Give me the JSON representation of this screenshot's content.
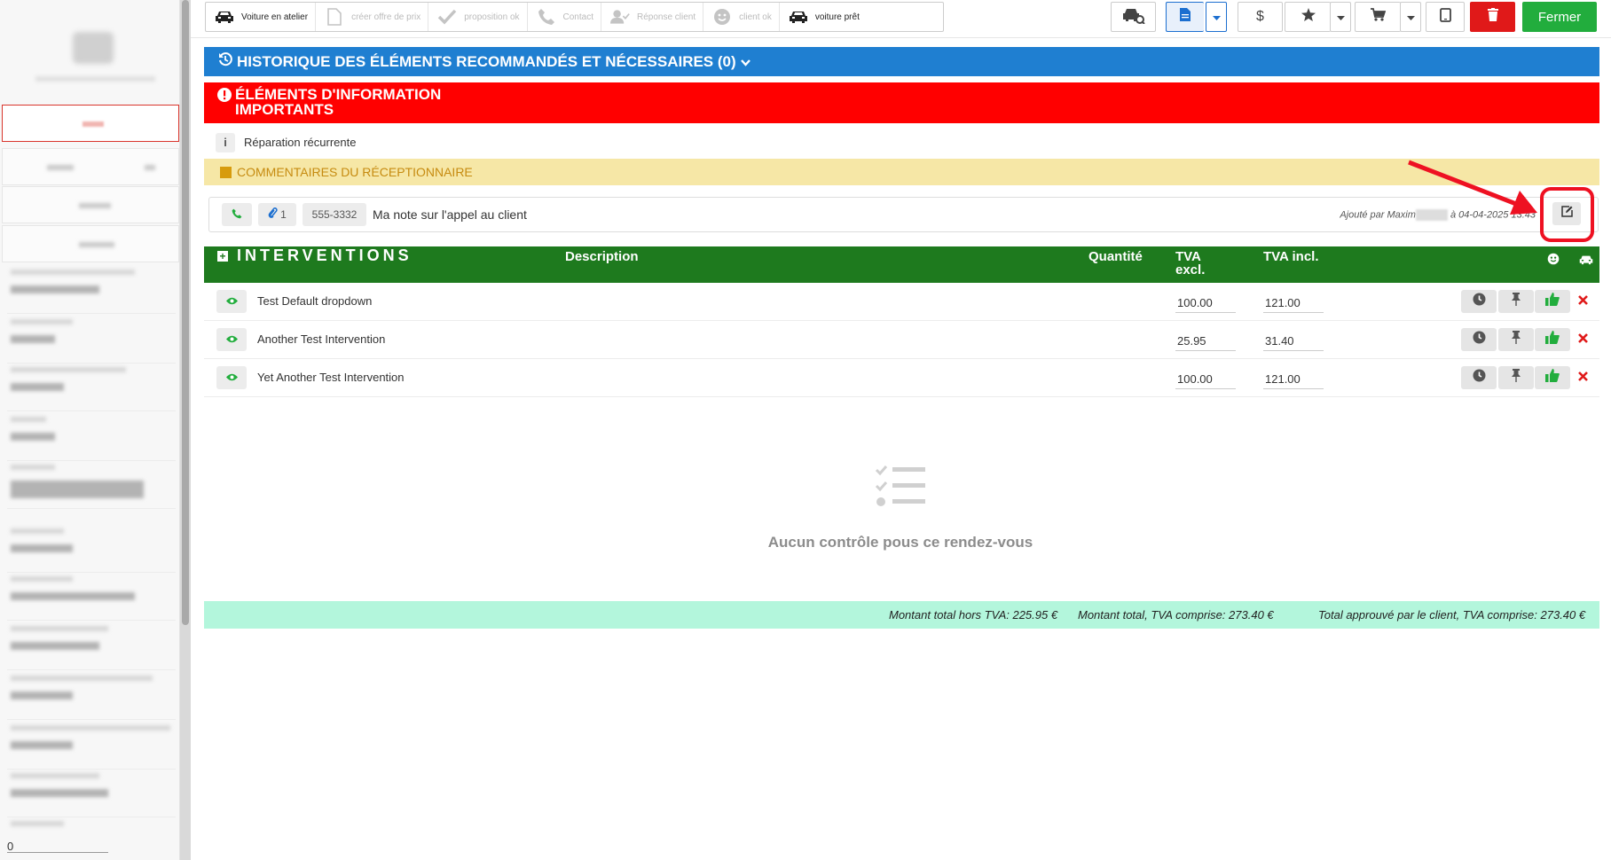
{
  "toolbar": {
    "steps": [
      {
        "label": "Voiture en atelier",
        "icon": "car-icon",
        "done": true
      },
      {
        "label": "créer offre de prix",
        "icon": "file-icon",
        "done": false
      },
      {
        "label": "proposition ok",
        "icon": "check-icon",
        "done": false
      },
      {
        "label": "Contact",
        "icon": "phone-icon",
        "done": false
      },
      {
        "label": "Réponse client",
        "icon": "user-check-icon",
        "done": false
      },
      {
        "label": "client ok",
        "icon": "smile-icon",
        "done": false
      },
      {
        "label": "voiture prêt",
        "icon": "car-icon",
        "done": true
      }
    ],
    "currency_label": "$",
    "close_label": "Fermer",
    "colors": {
      "danger": "#e01919",
      "success": "#22ad3d",
      "primary": "#1c6fd0"
    }
  },
  "history": {
    "title": "HISTORIQUE DES ÉLÉMENTS RECOMMANDÉS ET NÉCESSAIRES (0)",
    "color": "#1f7fd1"
  },
  "important": {
    "title": "ÉLÉMENTS D'INFORMATION IMPORTANTS",
    "color": "#ff0000",
    "items": [
      {
        "icon": "info-icon",
        "icon_glyph": "i",
        "text": "Réparation récurrente"
      }
    ]
  },
  "comments": {
    "title": "COMMENTAIRES DU RÉCEPTIONNAIRE",
    "note": {
      "attachments": "1",
      "phone": "555-3332",
      "text": "Ma note sur l'appel au client",
      "added_prefix": "Ajouté par Maxim",
      "added_suffix": "à 04-04-2025 13:43"
    }
  },
  "interventions": {
    "title": "INTERVENTIONS",
    "columns": {
      "description": "Description",
      "quantity": "Quantité",
      "vat_excl": "TVA excl.",
      "vat_incl": "TVA incl."
    },
    "rows": [
      {
        "name": "Test Default dropdown",
        "vat_excl": "100.00",
        "vat_incl": "121.00"
      },
      {
        "name": "Another Test Intervention",
        "vat_excl": "25.95",
        "vat_incl": "31.40"
      },
      {
        "name": "Yet Another Test Intervention",
        "vat_excl": "100.00",
        "vat_incl": "121.00"
      }
    ]
  },
  "empty_state": {
    "text": "Aucun contrôle pous ce rendez-vous"
  },
  "totals": {
    "excl": "Montant total hors TVA: 225.95 €",
    "incl": "Montant total, TVA comprise: 273.40 €",
    "approved": "Total approuvé par le client, TVA comprise: 273.40 €"
  },
  "sidebar": {
    "bottom_input_value": "0"
  }
}
